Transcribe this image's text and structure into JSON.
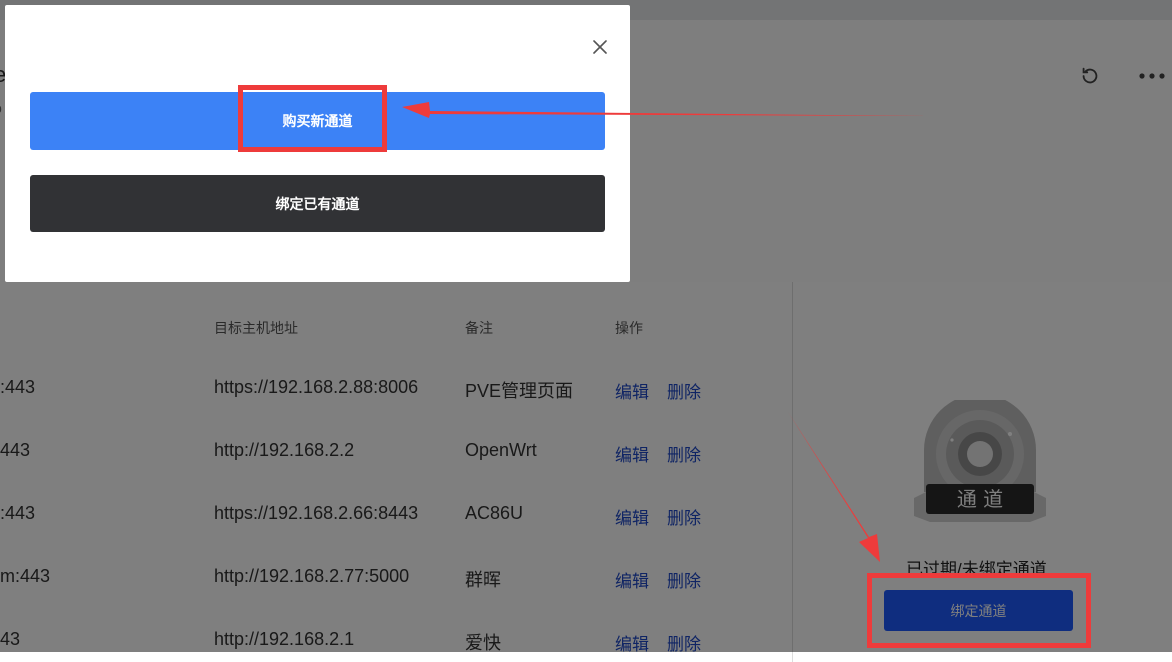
{
  "header": {
    "title_fragment": "e",
    "subtitle_fragment": "p",
    "warning_fragment": "!"
  },
  "toolbar": {
    "refresh_icon": "refresh-icon",
    "more_icon": "more-icon"
  },
  "table": {
    "columns": [
      "目标主机地址",
      "备注",
      "操作"
    ],
    "rows": [
      {
        "source": ":443",
        "target": "https://192.168.2.88:8006",
        "note": "PVE管理页面",
        "edit": "编辑",
        "delete": "删除"
      },
      {
        "source": "443",
        "target": "http://192.168.2.2",
        "note": "OpenWrt",
        "edit": "编辑",
        "delete": "删除"
      },
      {
        "source": ":443",
        "target": "https://192.168.2.66:8443",
        "note": "AC86U",
        "edit": "编辑",
        "delete": "删除"
      },
      {
        "source": "m:443",
        "target": "http://192.168.2.77:5000",
        "note": "群晖",
        "edit": "编辑",
        "delete": "删除"
      },
      {
        "source": "43",
        "target": "http://192.168.2.1",
        "note": "爱快",
        "edit": "编辑",
        "delete": "删除"
      }
    ]
  },
  "channel_panel": {
    "badge_text": "通 道",
    "status_text": "已过期/未绑定通道",
    "bind_button": "绑定通道"
  },
  "modal": {
    "close_icon": "close-icon",
    "buy_button": "购买新通道",
    "bind_existing_button": "绑定已有通道"
  },
  "colors": {
    "primary_blue": "#3c82f6",
    "dark_button": "#313235",
    "bind_blue": "#1f5bff",
    "link_blue": "#1e49c9",
    "highlight_red": "#ee3b3b",
    "overlay": "rgba(0,0,0,0.5)"
  }
}
